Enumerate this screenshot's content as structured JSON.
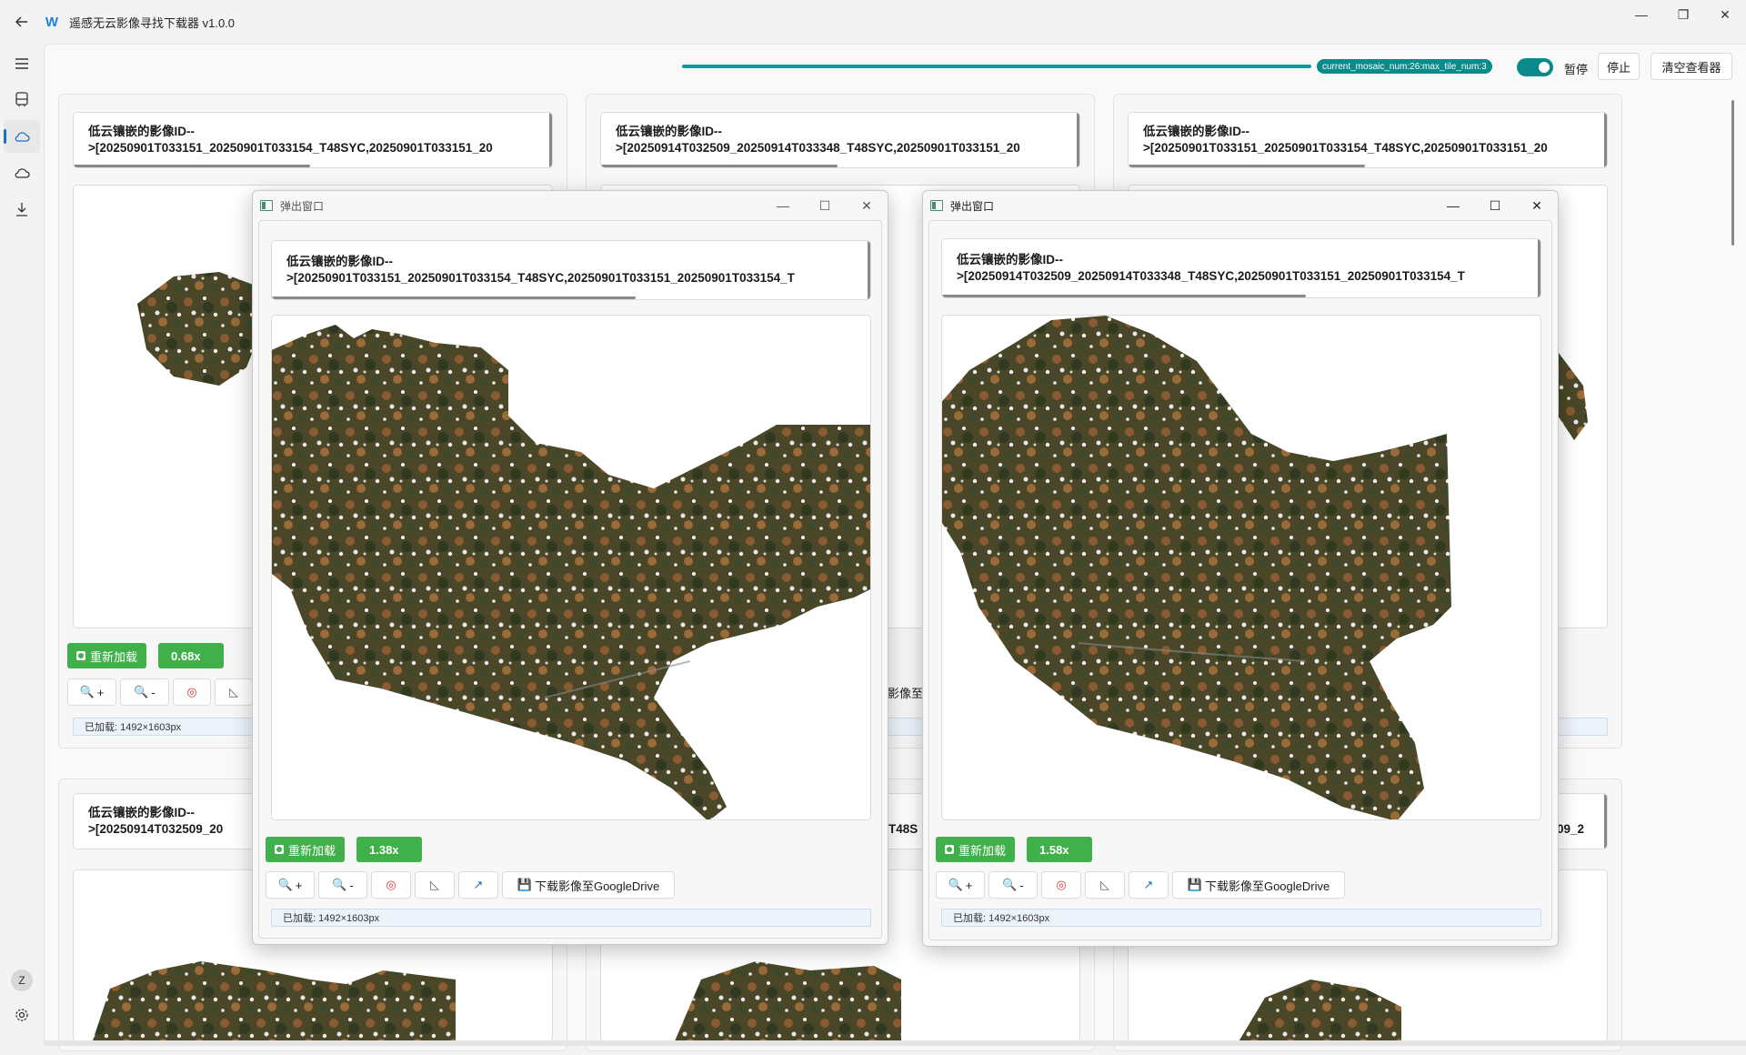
{
  "app": {
    "title": "遥感无云影像寻找下载器 v1.0.0",
    "logo_glyph": "W",
    "window_controls": {
      "minimize": "—",
      "maximize": "❐",
      "close": "✕"
    }
  },
  "nav": {
    "items": [
      "menu-icon",
      "bus-icon",
      "cloud-icon",
      "cloud-outline-icon",
      "download-icon"
    ],
    "avatar_letter": "Z",
    "settings": "gear-icon"
  },
  "toolbar": {
    "status_pill": "current_mosaic_num:26:max_tile_num:3",
    "toggle_label": "暂停",
    "toggle_on": true,
    "stop_label": "停止",
    "clear_label": "清空查看器"
  },
  "card_label": "低云镶嵌的影像ID--",
  "cards": [
    {
      "id_line": ">[20250901T033151_20250901T033154_T48SYC,20250901T033151_20",
      "zoom": "0.68x",
      "loaded": "已加载: 1492×1603px"
    },
    {
      "id_line": ">[20250914T032509_20250914T033348_T48SYC,20250901T033151_20",
      "zoom": "",
      "loaded": ""
    },
    {
      "id_line": ">[20250901T033151_20250901T033154_T48SYC,20250901T033151_20",
      "zoom": "",
      "loaded": ""
    },
    {
      "id_line": ">[20250914T032509_20",
      "zoom": "",
      "loaded": ""
    },
    {
      "id_line": "T48S",
      "zoom": "",
      "loaded": ""
    },
    {
      "id_line": "2509_2",
      "zoom": "",
      "loaded": ""
    }
  ],
  "partial_text": "影像至",
  "popups": [
    {
      "title": "弹出窗口",
      "id_label": "低云镶嵌的影像ID--",
      "id_line": ">[20250901T033151_20250901T033154_T48SYC,20250901T033151_20250901T033154_T",
      "reload": "重新加载",
      "zoom": "1.38x",
      "download": "下载影像至GoogleDrive",
      "loaded": "已加载: 1492×1603px"
    },
    {
      "title": "弹出窗口",
      "id_label": "低云镶嵌的影像ID--",
      "id_line": ">[20250914T032509_20250914T033348_T48SYC,20250901T033151_20250901T033154_T",
      "reload": "重新加载",
      "zoom": "1.58x",
      "download": "下载影像至GoogleDrive",
      "loaded": "已加载: 1492×1603px"
    }
  ],
  "tools": {
    "zoom_in": "+",
    "zoom_out": "-",
    "reload": "重新加载"
  },
  "colors": {
    "accent": "#0a8a8a",
    "reload_green": "#3fb04a",
    "terrain_dark": "#3a3a22",
    "terrain_brown": "#8a5a30"
  }
}
